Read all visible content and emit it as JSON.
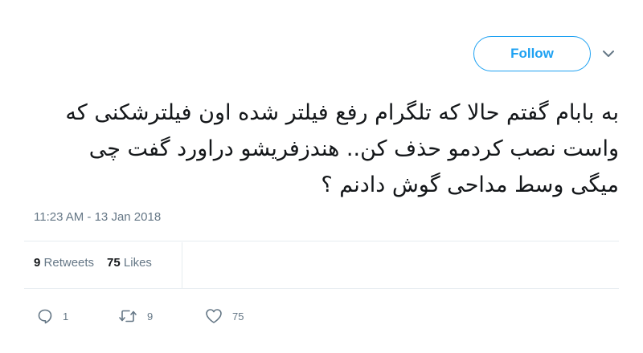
{
  "header": {
    "follow_label": "Follow",
    "colors": {
      "accent": "#1da1f2",
      "text": "#14171a",
      "muted": "#657786",
      "divider": "#e6ecf0"
    }
  },
  "tweet": {
    "lines": [
      "به بابام گفتم حالا که تلگرام رفع فیلتر شده اون فیلترشکنی که",
      "واست نصب کردمو حذف کن.. هندزفریشو دراورد گفت چی",
      "میگی وسط مداحی گوش دادنم ؟"
    ],
    "timestamp": "11:23 AM - 13 Jan 2018"
  },
  "stats": {
    "retweets_count": "9",
    "retweets_label": "Retweets",
    "likes_count": "75",
    "likes_label": "Likes"
  },
  "actions": {
    "reply": {
      "icon": "reply-icon",
      "count": "1"
    },
    "retweet": {
      "icon": "retweet-icon",
      "count": "9"
    },
    "like": {
      "icon": "heart-icon",
      "count": "75"
    }
  }
}
